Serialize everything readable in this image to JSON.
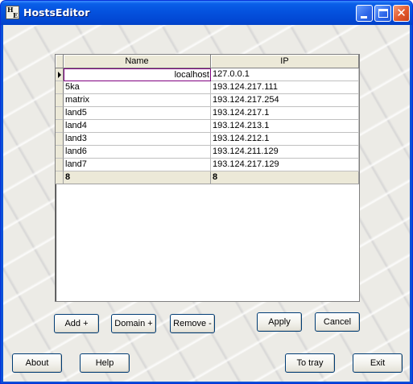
{
  "window": {
    "title": "HostsEditor",
    "icon_glyphs": [
      "H",
      "E"
    ]
  },
  "table": {
    "columns": [
      "Name",
      "IP"
    ],
    "rows": [
      {
        "name": "localhost",
        "ip": "127.0.0.1"
      },
      {
        "name": "5ka",
        "ip": "193.124.217.111"
      },
      {
        "name": "matrix",
        "ip": "193.124.217.254"
      },
      {
        "name": "land5",
        "ip": "193.124.217.1"
      },
      {
        "name": "land4",
        "ip": "193.124.213.1"
      },
      {
        "name": "land3",
        "ip": "193.124.212.1"
      },
      {
        "name": "land6",
        "ip": "193.124.211.129"
      },
      {
        "name": "land7",
        "ip": "193.124.217.129"
      }
    ],
    "footer": {
      "name_count": "8",
      "ip_count": "8"
    }
  },
  "buttons": {
    "add": "Add +",
    "domain": "Domain +",
    "remove": "Remove -",
    "apply": "Apply",
    "cancel": "Cancel",
    "about": "About",
    "help": "Help",
    "to_tray": "To tray",
    "exit": "Exit"
  },
  "colors": {
    "titlebar": "#0554e0",
    "edit_border": "#800080"
  }
}
